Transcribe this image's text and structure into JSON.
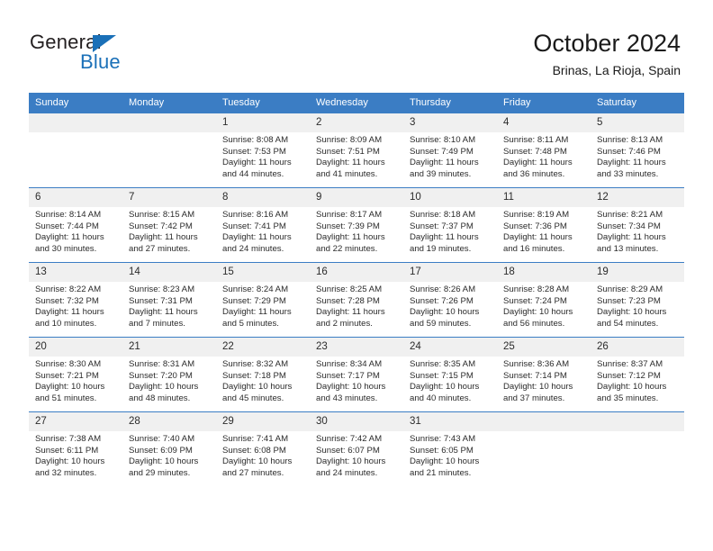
{
  "brand": {
    "name_top": "General",
    "name_bottom": "Blue",
    "triangle_color": "#1a70b8"
  },
  "header": {
    "title": "October 2024",
    "subtitle": "Brinas, La Rioja, Spain"
  },
  "theme": {
    "header_blue": "#3b7dc4",
    "daynum_band": "#f0f0f0",
    "text": "#2b2b2b"
  },
  "weekday_headers": [
    "Sunday",
    "Monday",
    "Tuesday",
    "Wednesday",
    "Thursday",
    "Friday",
    "Saturday"
  ],
  "weeks": [
    [
      {
        "day": "",
        "empty": true,
        "sunrise": "",
        "sunset": "",
        "daylight_line1": "",
        "daylight_line2": ""
      },
      {
        "day": "",
        "empty": true,
        "sunrise": "",
        "sunset": "",
        "daylight_line1": "",
        "daylight_line2": ""
      },
      {
        "day": "1",
        "empty": false,
        "sunrise": "Sunrise: 8:08 AM",
        "sunset": "Sunset: 7:53 PM",
        "daylight_line1": "Daylight: 11 hours",
        "daylight_line2": "and 44 minutes."
      },
      {
        "day": "2",
        "empty": false,
        "sunrise": "Sunrise: 8:09 AM",
        "sunset": "Sunset: 7:51 PM",
        "daylight_line1": "Daylight: 11 hours",
        "daylight_line2": "and 41 minutes."
      },
      {
        "day": "3",
        "empty": false,
        "sunrise": "Sunrise: 8:10 AM",
        "sunset": "Sunset: 7:49 PM",
        "daylight_line1": "Daylight: 11 hours",
        "daylight_line2": "and 39 minutes."
      },
      {
        "day": "4",
        "empty": false,
        "sunrise": "Sunrise: 8:11 AM",
        "sunset": "Sunset: 7:48 PM",
        "daylight_line1": "Daylight: 11 hours",
        "daylight_line2": "and 36 minutes."
      },
      {
        "day": "5",
        "empty": false,
        "sunrise": "Sunrise: 8:13 AM",
        "sunset": "Sunset: 7:46 PM",
        "daylight_line1": "Daylight: 11 hours",
        "daylight_line2": "and 33 minutes."
      }
    ],
    [
      {
        "day": "6",
        "empty": false,
        "sunrise": "Sunrise: 8:14 AM",
        "sunset": "Sunset: 7:44 PM",
        "daylight_line1": "Daylight: 11 hours",
        "daylight_line2": "and 30 minutes."
      },
      {
        "day": "7",
        "empty": false,
        "sunrise": "Sunrise: 8:15 AM",
        "sunset": "Sunset: 7:42 PM",
        "daylight_line1": "Daylight: 11 hours",
        "daylight_line2": "and 27 minutes."
      },
      {
        "day": "8",
        "empty": false,
        "sunrise": "Sunrise: 8:16 AM",
        "sunset": "Sunset: 7:41 PM",
        "daylight_line1": "Daylight: 11 hours",
        "daylight_line2": "and 24 minutes."
      },
      {
        "day": "9",
        "empty": false,
        "sunrise": "Sunrise: 8:17 AM",
        "sunset": "Sunset: 7:39 PM",
        "daylight_line1": "Daylight: 11 hours",
        "daylight_line2": "and 22 minutes."
      },
      {
        "day": "10",
        "empty": false,
        "sunrise": "Sunrise: 8:18 AM",
        "sunset": "Sunset: 7:37 PM",
        "daylight_line1": "Daylight: 11 hours",
        "daylight_line2": "and 19 minutes."
      },
      {
        "day": "11",
        "empty": false,
        "sunrise": "Sunrise: 8:19 AM",
        "sunset": "Sunset: 7:36 PM",
        "daylight_line1": "Daylight: 11 hours",
        "daylight_line2": "and 16 minutes."
      },
      {
        "day": "12",
        "empty": false,
        "sunrise": "Sunrise: 8:21 AM",
        "sunset": "Sunset: 7:34 PM",
        "daylight_line1": "Daylight: 11 hours",
        "daylight_line2": "and 13 minutes."
      }
    ],
    [
      {
        "day": "13",
        "empty": false,
        "sunrise": "Sunrise: 8:22 AM",
        "sunset": "Sunset: 7:32 PM",
        "daylight_line1": "Daylight: 11 hours",
        "daylight_line2": "and 10 minutes."
      },
      {
        "day": "14",
        "empty": false,
        "sunrise": "Sunrise: 8:23 AM",
        "sunset": "Sunset: 7:31 PM",
        "daylight_line1": "Daylight: 11 hours",
        "daylight_line2": "and 7 minutes."
      },
      {
        "day": "15",
        "empty": false,
        "sunrise": "Sunrise: 8:24 AM",
        "sunset": "Sunset: 7:29 PM",
        "daylight_line1": "Daylight: 11 hours",
        "daylight_line2": "and 5 minutes."
      },
      {
        "day": "16",
        "empty": false,
        "sunrise": "Sunrise: 8:25 AM",
        "sunset": "Sunset: 7:28 PM",
        "daylight_line1": "Daylight: 11 hours",
        "daylight_line2": "and 2 minutes."
      },
      {
        "day": "17",
        "empty": false,
        "sunrise": "Sunrise: 8:26 AM",
        "sunset": "Sunset: 7:26 PM",
        "daylight_line1": "Daylight: 10 hours",
        "daylight_line2": "and 59 minutes."
      },
      {
        "day": "18",
        "empty": false,
        "sunrise": "Sunrise: 8:28 AM",
        "sunset": "Sunset: 7:24 PM",
        "daylight_line1": "Daylight: 10 hours",
        "daylight_line2": "and 56 minutes."
      },
      {
        "day": "19",
        "empty": false,
        "sunrise": "Sunrise: 8:29 AM",
        "sunset": "Sunset: 7:23 PM",
        "daylight_line1": "Daylight: 10 hours",
        "daylight_line2": "and 54 minutes."
      }
    ],
    [
      {
        "day": "20",
        "empty": false,
        "sunrise": "Sunrise: 8:30 AM",
        "sunset": "Sunset: 7:21 PM",
        "daylight_line1": "Daylight: 10 hours",
        "daylight_line2": "and 51 minutes."
      },
      {
        "day": "21",
        "empty": false,
        "sunrise": "Sunrise: 8:31 AM",
        "sunset": "Sunset: 7:20 PM",
        "daylight_line1": "Daylight: 10 hours",
        "daylight_line2": "and 48 minutes."
      },
      {
        "day": "22",
        "empty": false,
        "sunrise": "Sunrise: 8:32 AM",
        "sunset": "Sunset: 7:18 PM",
        "daylight_line1": "Daylight: 10 hours",
        "daylight_line2": "and 45 minutes."
      },
      {
        "day": "23",
        "empty": false,
        "sunrise": "Sunrise: 8:34 AM",
        "sunset": "Sunset: 7:17 PM",
        "daylight_line1": "Daylight: 10 hours",
        "daylight_line2": "and 43 minutes."
      },
      {
        "day": "24",
        "empty": false,
        "sunrise": "Sunrise: 8:35 AM",
        "sunset": "Sunset: 7:15 PM",
        "daylight_line1": "Daylight: 10 hours",
        "daylight_line2": "and 40 minutes."
      },
      {
        "day": "25",
        "empty": false,
        "sunrise": "Sunrise: 8:36 AM",
        "sunset": "Sunset: 7:14 PM",
        "daylight_line1": "Daylight: 10 hours",
        "daylight_line2": "and 37 minutes."
      },
      {
        "day": "26",
        "empty": false,
        "sunrise": "Sunrise: 8:37 AM",
        "sunset": "Sunset: 7:12 PM",
        "daylight_line1": "Daylight: 10 hours",
        "daylight_line2": "and 35 minutes."
      }
    ],
    [
      {
        "day": "27",
        "empty": false,
        "sunrise": "Sunrise: 7:38 AM",
        "sunset": "Sunset: 6:11 PM",
        "daylight_line1": "Daylight: 10 hours",
        "daylight_line2": "and 32 minutes."
      },
      {
        "day": "28",
        "empty": false,
        "sunrise": "Sunrise: 7:40 AM",
        "sunset": "Sunset: 6:09 PM",
        "daylight_line1": "Daylight: 10 hours",
        "daylight_line2": "and 29 minutes."
      },
      {
        "day": "29",
        "empty": false,
        "sunrise": "Sunrise: 7:41 AM",
        "sunset": "Sunset: 6:08 PM",
        "daylight_line1": "Daylight: 10 hours",
        "daylight_line2": "and 27 minutes."
      },
      {
        "day": "30",
        "empty": false,
        "sunrise": "Sunrise: 7:42 AM",
        "sunset": "Sunset: 6:07 PM",
        "daylight_line1": "Daylight: 10 hours",
        "daylight_line2": "and 24 minutes."
      },
      {
        "day": "31",
        "empty": false,
        "sunrise": "Sunrise: 7:43 AM",
        "sunset": "Sunset: 6:05 PM",
        "daylight_line1": "Daylight: 10 hours",
        "daylight_line2": "and 21 minutes."
      },
      {
        "day": "",
        "empty": true,
        "sunrise": "",
        "sunset": "",
        "daylight_line1": "",
        "daylight_line2": ""
      },
      {
        "day": "",
        "empty": true,
        "sunrise": "",
        "sunset": "",
        "daylight_line1": "",
        "daylight_line2": ""
      }
    ]
  ]
}
